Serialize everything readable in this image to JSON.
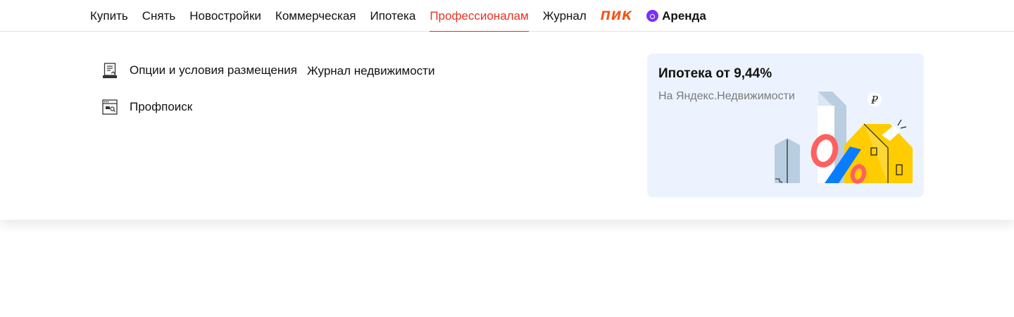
{
  "nav": {
    "items": [
      {
        "label": "Купить"
      },
      {
        "label": "Снять"
      },
      {
        "label": "Новостройки"
      },
      {
        "label": "Коммерческая"
      },
      {
        "label": "Ипотека"
      },
      {
        "label": "Профессионалам",
        "active": true
      },
      {
        "label": "Журнал"
      }
    ],
    "pik_logo": "ПИК",
    "arenda_label": "Аренда"
  },
  "dropdown": {
    "links": [
      {
        "label": "Опции и условия размещения",
        "icon": "document-stamp-icon"
      },
      {
        "label": "Журнал недвижимости"
      },
      {
        "label": "Профпоиск",
        "icon": "browser-search-icon"
      }
    ],
    "promo": {
      "title": "Ипотека от 9,44%",
      "subtitle": "На Яндекс.Недвижимости",
      "illustration": "house-percent-illustration"
    }
  },
  "colors": {
    "accent": "#e8331f",
    "pik": "#f2541b",
    "arenda": "#7b2ff7",
    "promo_bg": "#ecf3fe"
  }
}
